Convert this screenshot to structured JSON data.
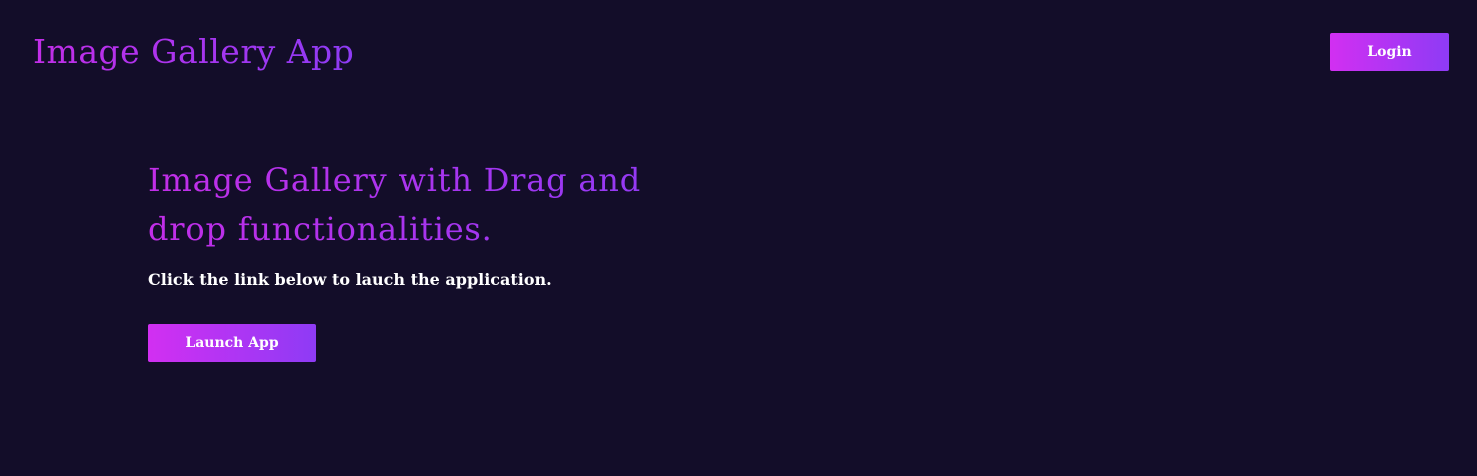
{
  "header": {
    "title": "Image Gallery App",
    "login_label": "Login"
  },
  "hero": {
    "heading": "Image Gallery with Drag and drop functionalities.",
    "subtext": "Click the link below to lauch the application.",
    "launch_label": "Launch App"
  },
  "colors": {
    "background": "#130d29",
    "accent_start": "#d22ff2",
    "accent_end": "#8e3bf5",
    "text": "#ffffff"
  }
}
